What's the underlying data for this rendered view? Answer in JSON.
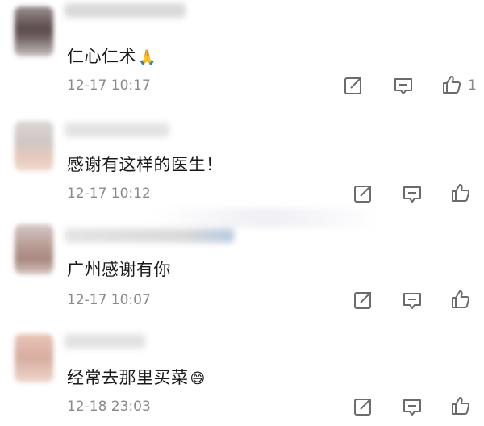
{
  "comments": [
    {
      "text": "仁心仁术",
      "emoji": "🙏",
      "time": "12-17 10:17",
      "likes": "1"
    },
    {
      "text": "感谢有这样的医生！",
      "emoji": "",
      "time": "12-17 10:12",
      "likes": ""
    },
    {
      "text": "广州感谢有你",
      "emoji": "",
      "time": "12-17 10:07",
      "likes": ""
    },
    {
      "text": "经常去那里买菜",
      "emoji": "😄",
      "time": "12-18 23:03",
      "likes": ""
    }
  ],
  "colors": {
    "text": "#1a1a1a",
    "meta": "#8a8a8a",
    "icon": "#6b6b6b"
  },
  "icons": [
    "share-icon",
    "comment-icon",
    "like-icon"
  ]
}
